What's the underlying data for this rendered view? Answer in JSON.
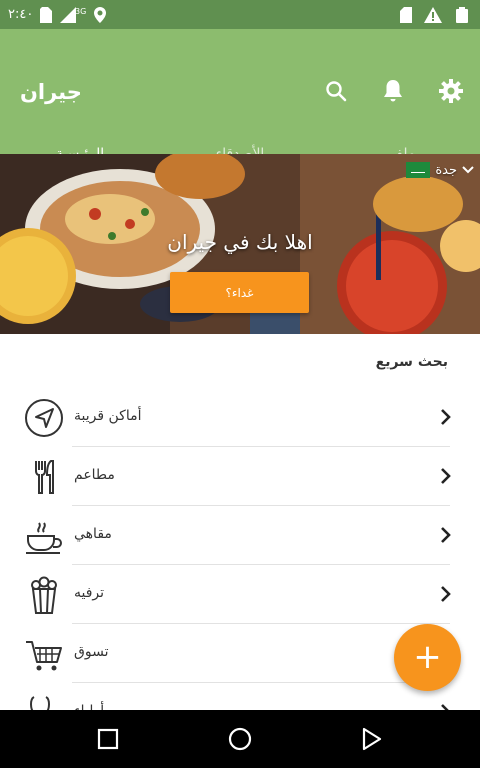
{
  "status_bar": {
    "time": "٢:٤٠",
    "network": "3G",
    "icons": [
      "sim-icon",
      "signal-icon",
      "location-icon",
      "sd-card-icon",
      "warning-icon",
      "battery-icon"
    ]
  },
  "app_bar": {
    "title": "جيران",
    "actions": [
      "search-icon",
      "bell-icon",
      "gear-icon"
    ]
  },
  "tabs": [
    {
      "label": "ملفي",
      "active": false
    },
    {
      "label": "الأصدقاء",
      "active": false
    },
    {
      "label": "الرئيسية",
      "active": true
    }
  ],
  "hero": {
    "city": "جدة",
    "title": "اهلا بك في جيران",
    "button_label": "غداء؟"
  },
  "quick_search": {
    "title": "بحث سريع",
    "items": [
      {
        "label": "أماكن قريبة",
        "icon": "navigation-arrow-icon"
      },
      {
        "label": "مطاعم",
        "icon": "fork-knife-icon"
      },
      {
        "label": "مقاهي",
        "icon": "coffee-cup-icon"
      },
      {
        "label": "ترفيه",
        "icon": "popcorn-icon"
      },
      {
        "label": "تسوق",
        "icon": "shopping-cart-icon"
      },
      {
        "label": "أطباء",
        "icon": "stethoscope-icon"
      }
    ]
  },
  "fab": {
    "label": "+"
  },
  "colors": {
    "primary": "#8cbc6e",
    "status_bar": "#609050",
    "accent": "#f7941d"
  }
}
